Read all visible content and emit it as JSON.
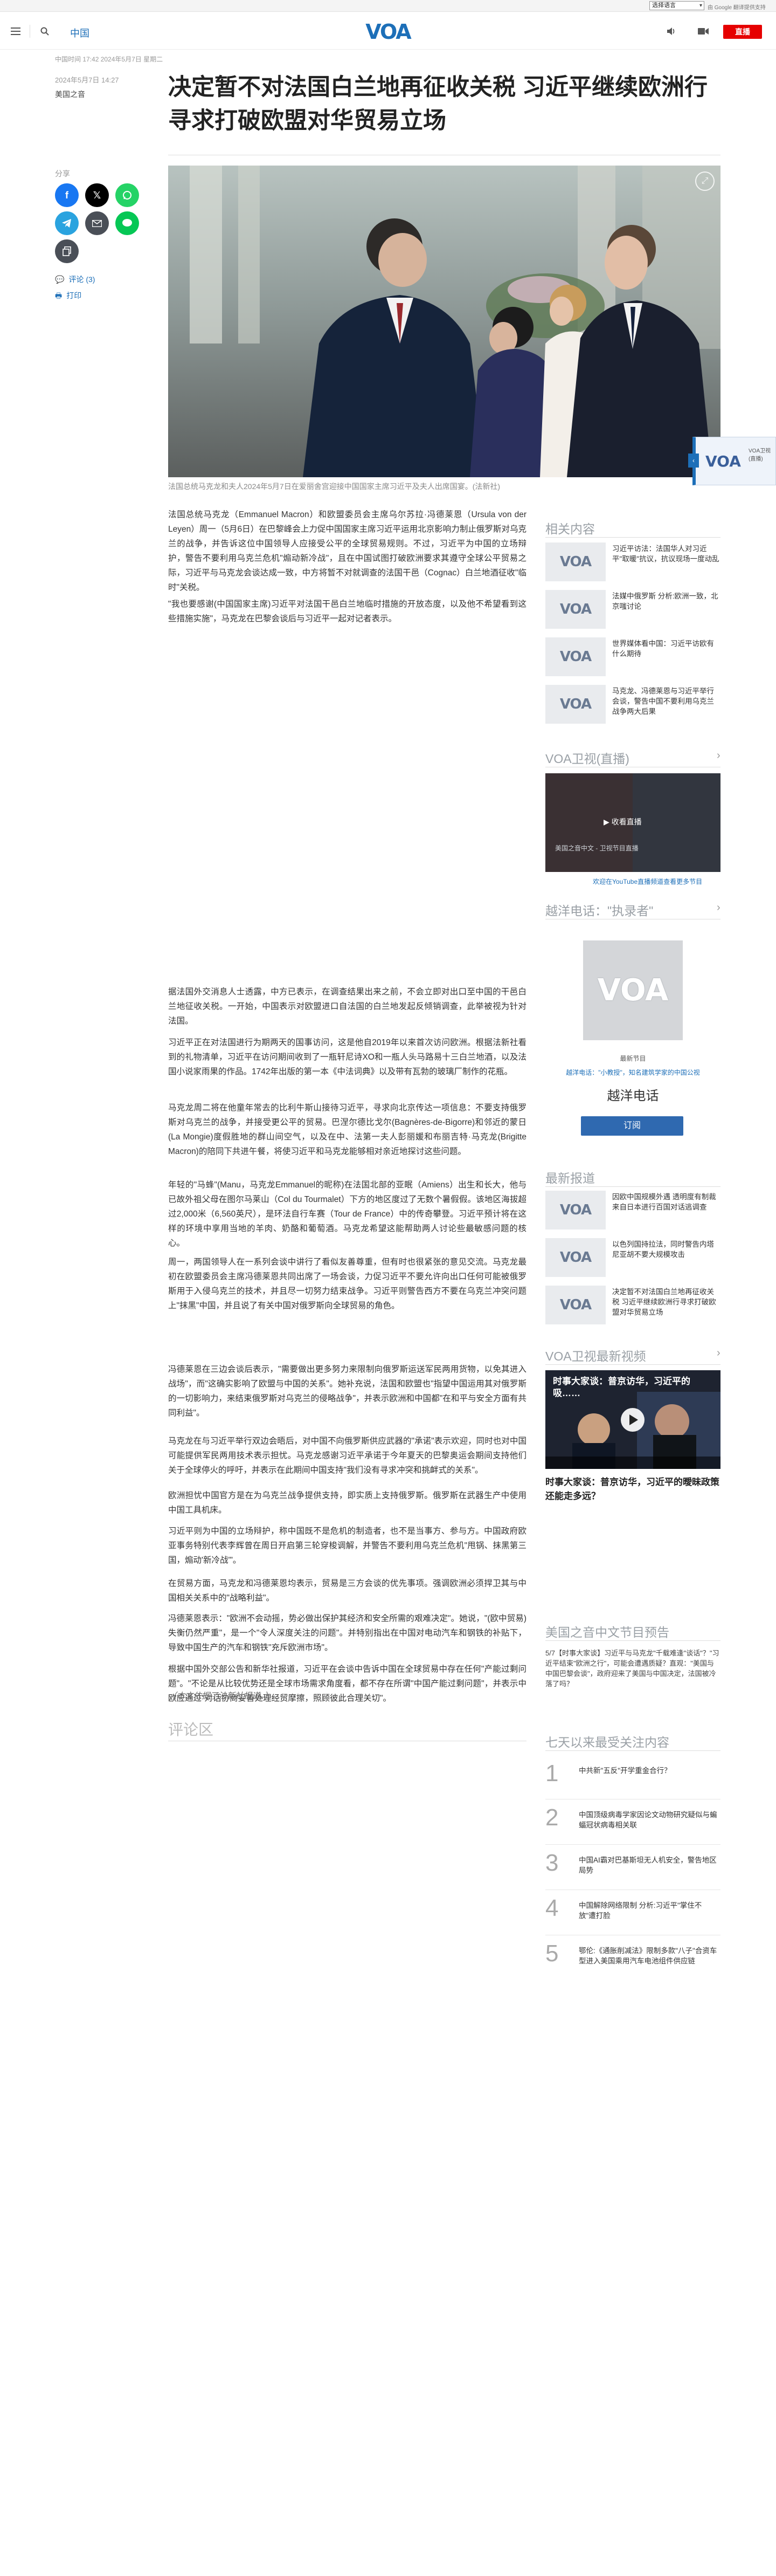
{
  "topbar": {
    "language": "选择语言",
    "powered_by": "由 Google 翻译提供支持"
  },
  "header": {
    "section": "中国",
    "logo_text": "VOA",
    "live_label": "直播"
  },
  "article": {
    "breadcrumb": "中国时间 17:42 2024年5月7日 星期二",
    "date": "2024年5月7日 14:27",
    "author": "美国之音",
    "title": "决定暂不对法国白兰地再征收关税 习近平继续欧洲行寻求打破欧盟对华贸易立场",
    "share_label": "分享",
    "comment_link": "评论 (3)",
    "print_link": "打印",
    "caption": "法国总统马克龙和夫人2024年5月7日在爱丽舍宫迎接中国国家主席习近平及夫人出席国宴。(法新社)",
    "paragraphs": [
      "法国总统马克龙（Emmanuel Macron）和欧盟委员会主席乌尔苏拉·冯德莱恩（Ursula von der Leyen）周一（5月6日）在巴黎峰会上力促中国国家主席习近平运用北京影响力制止俄罗斯对乌克兰的战争，并告诉这位中国领导人应接受公平的全球贸易规则。不过，习近平为中国的立场辩护，警告不要利用乌克兰危机\"煽动新冷战\"，且在中国试图打破欧洲要求其遵守全球公平贸易之际，习近平与马克龙会谈达成一致，中方将暂不对就调查的法国干邑（Cognac）白兰地酒征收\"临时\"关税。",
      "\"我也要感谢(中国国家主席)习近平对法国干邑白兰地临时措施的开放态度，以及他不希望看到这些措施实施\"，马克龙在巴黎会谈后与习近平一起对记者表示。",
      "据法国外交消息人士透露，中方已表示，在调查结果出来之前，不会立即对出口至中国的干邑白兰地征收关税。一开始，中国表示对欧盟进口自法国的白兰地发起反倾销调查，此举被视为针对法国。",
      "习近平正在对法国进行为期两天的国事访问，这是他自2019年以来首次访问欧洲。根据法新社看到的礼物清单，习近平在访问期间收到了一瓶轩尼诗XO和一瓶人头马路易十三白兰地酒，以及法国小说家雨果的作品。1742年出版的第一本《中法词典》以及带有瓦勃的玻璃厂制作的花瓶。",
      "马克龙周二将在他童年常去的比利牛斯山接待习近平，寻求向北京传达一项信息：不要支持俄罗斯对乌克兰的战争，并接受更公平的贸易。巴涅尔德比戈尔(Bagnères-de-Bigorre)和邻近的蒙日(La Mongie)度假胜地的群山间空气，以及在中、法第一夫人彭丽媛和布丽吉特·马克龙(Brigitte Macron)的陪同下共进午餐，将使习近平和马克龙能够相对亲近地探讨这些问题。",
      "年轻的\"马蜂\"(Manu，马克龙Emmanuel的昵称)在法国北部的亚眠（Amiens）出生和长大，他与已故外祖父母在图尔马莱山（Col du Tourmalet）下方的地区度过了无数个暑假假。该地区海拔超过2,000米（6,560英尺），是环法自行车赛（Tour de France）中的传奇攀登。习近平预计将在这样的环境中享用当地的羊肉、奶酪和葡萄酒。马克龙希望这能帮助两人讨论些最敏感问题的核心。",
      "周一，两国领导人在一系列会谈中讲行了看似友善尊重，但有时也很紧张的意见交流。马克龙最初在欧盟委员会主席冯德莱恩共同出席了一场会谈，力促习近平不要允许向出口任何可能被俄罗斯用于入侵乌克兰的技术，并且尽一切努力结束战争。习近平则警告西方不要在乌克兰冲突问题上\"抹黑\"中国，并且说了有关中国对俄罗斯向全球贸易的角色。",
      "冯德莱恩在三边会谈后表示，\"需要做出更多努力来限制向俄罗斯运送军民两用货物，以免其进入战场\"，而\"这确实影响了欧盟与中国的关系\"。她补充说，法国和欧盟也\"指望中国运用其对俄罗斯的一切影响力，来结束俄罗斯对乌克兰的侵略战争\"，并表示欧洲和中国都\"在和平与安全方面有共同利益\"。",
      "马克龙在与习近平举行双边会晤后，对中国不向俄罗斯供应武器的\"承诺\"表示欢迎，同时也对中国可能提供军民两用技术表示担忧。马克龙感谢习近平承诺于今年夏天的巴黎奥运会期间支持他们关于全球停火的呼吁，并表示在此期间中国支持\"我们没有寻求冲突和挑衅式的关系\"。",
      "欧洲担忧中国官方是在为乌克兰战争提供支持，即实质上支持俄罗斯。俄罗斯在武器生产中使用中国工具机床。",
      "习近平则为中国的立场辩护，称中国既不是危机的制造者，也不是当事方、参与方。中国政府欧亚事务特别代表李辉曾在周日开启第三轮穿梭调解，并警告不要利用乌克兰危机\"甩锅、抹黑第三国，煽动'新冷战'\"。",
      "在贸易方面，马克龙和冯德莱恩均表示，贸易是三方会谈的优先事项。强调欧洲必须捍卫其与中国相关关系中的\"战略利益\"。",
      "冯德莱恩表示：\"欧洲不会动摇，势必做出保护其经济和安全所需的艰难决定\"。她说，\"(欧中贸易)失衡仍然严重\"，是一个\"令人深度关注的问题\"。并特别指出在中国对电动汽车和钢铁的补贴下，导致中国生产的汽车和钢铁\"充斥欧洲市场\"。",
      "根据中国外交部公告和新华社报道，习近平在会谈中告诉中国在全球贸易中存在任何\"产能过剩问题\"。\"不论是从比较优势还是全球市场需求角度看，都不存在所谓\"中国产能过剩问题\"，并表示中欧应通过\"对话协商妥善处理经贸摩擦，照顾彼此合理关切\"。",
      "（本文依据了法新社报道。）"
    ],
    "comments_heading": "评论区"
  },
  "sidebar": {
    "related_heading": "相关内容",
    "related": [
      "习近平访法：法国华人对习近平\"取暖\"抗议，抗议现场一度动乱",
      "法媒中俄罗斯 分析:欧洲一致，北京嗤讨论",
      "世界媒体看中国：习近平访欧有什么期待",
      "马克龙、冯德莱恩与习近平举行会谈，警告中国不要利用乌克兰战争两大后果"
    ],
    "tv_heading": "VOA卫视(直播)",
    "tv_label": "▶ 收看直播",
    "tv_sub": "美国之音中文 - 卫视节目直播",
    "tv_link": "欢迎在YouTube直播频道查看更多节目",
    "phone_heading": "越洋电话：\"执录者\"",
    "phone_program": "最新节目",
    "phone_desc": "越洋电话：\"小教授\"，知名建筑学家的中国公视",
    "phone_name": "越洋电话",
    "subscribe_label": "订阅",
    "latest_heading": "最新报道",
    "latest": [
      "因欧中国规模外遇 透明度有制裁来自日本进行百国对话逃调查",
      "以色列国持拉法，同时警告内塔尼亚胡不要大规模攻击",
      "决定暂不对法国白兰地再征收关税 习近平继续欧洲行寻求打破欧盟对华贸易立场"
    ],
    "video_heading": "VOA卫视最新视频",
    "video_overlay": "时事大家谈：普京访华，习近平的吸……",
    "video_title": "时事大家谈：普京访华，习近平的曖昧政策还能走多远？",
    "preview_heading": "美国之音中文节目预告",
    "preview_text": "5/7【时事大家谈】习近平与马克龙\"千载难逢\"谈话\"？\"习近平结束\"欧洲之行\"，可能会遭遇质疑？直观：\"美国与中国巴黎会谈\"，政府迎来了美国与中国决定，法国被冷落了吗？",
    "rank_heading": "七天以来最受关注内容",
    "ranks": [
      {
        "num": "1",
        "title": "中共新\"五反\"开学重金合行？"
      },
      {
        "num": "2",
        "title": "中国顶级病毒学家因论文动物研究疑似与蝙蝠冠状病毒相关联"
      },
      {
        "num": "3",
        "title": "中国AI霸对巴基斯坦无人机安全，警告地区局势"
      },
      {
        "num": "4",
        "title": "中国解除网络限制 分析:习近平\"掌住不放\"遭打脸"
      },
      {
        "num": "5",
        "title": "鄂伦:《通胀削减法》限制多款\"八子\"合资车型进入美国乘用汽车电池组件供应链"
      }
    ]
  },
  "colors": {
    "accent": "#1d6fb8",
    "live": "#e60000",
    "subscribe": "#2f69b0"
  }
}
